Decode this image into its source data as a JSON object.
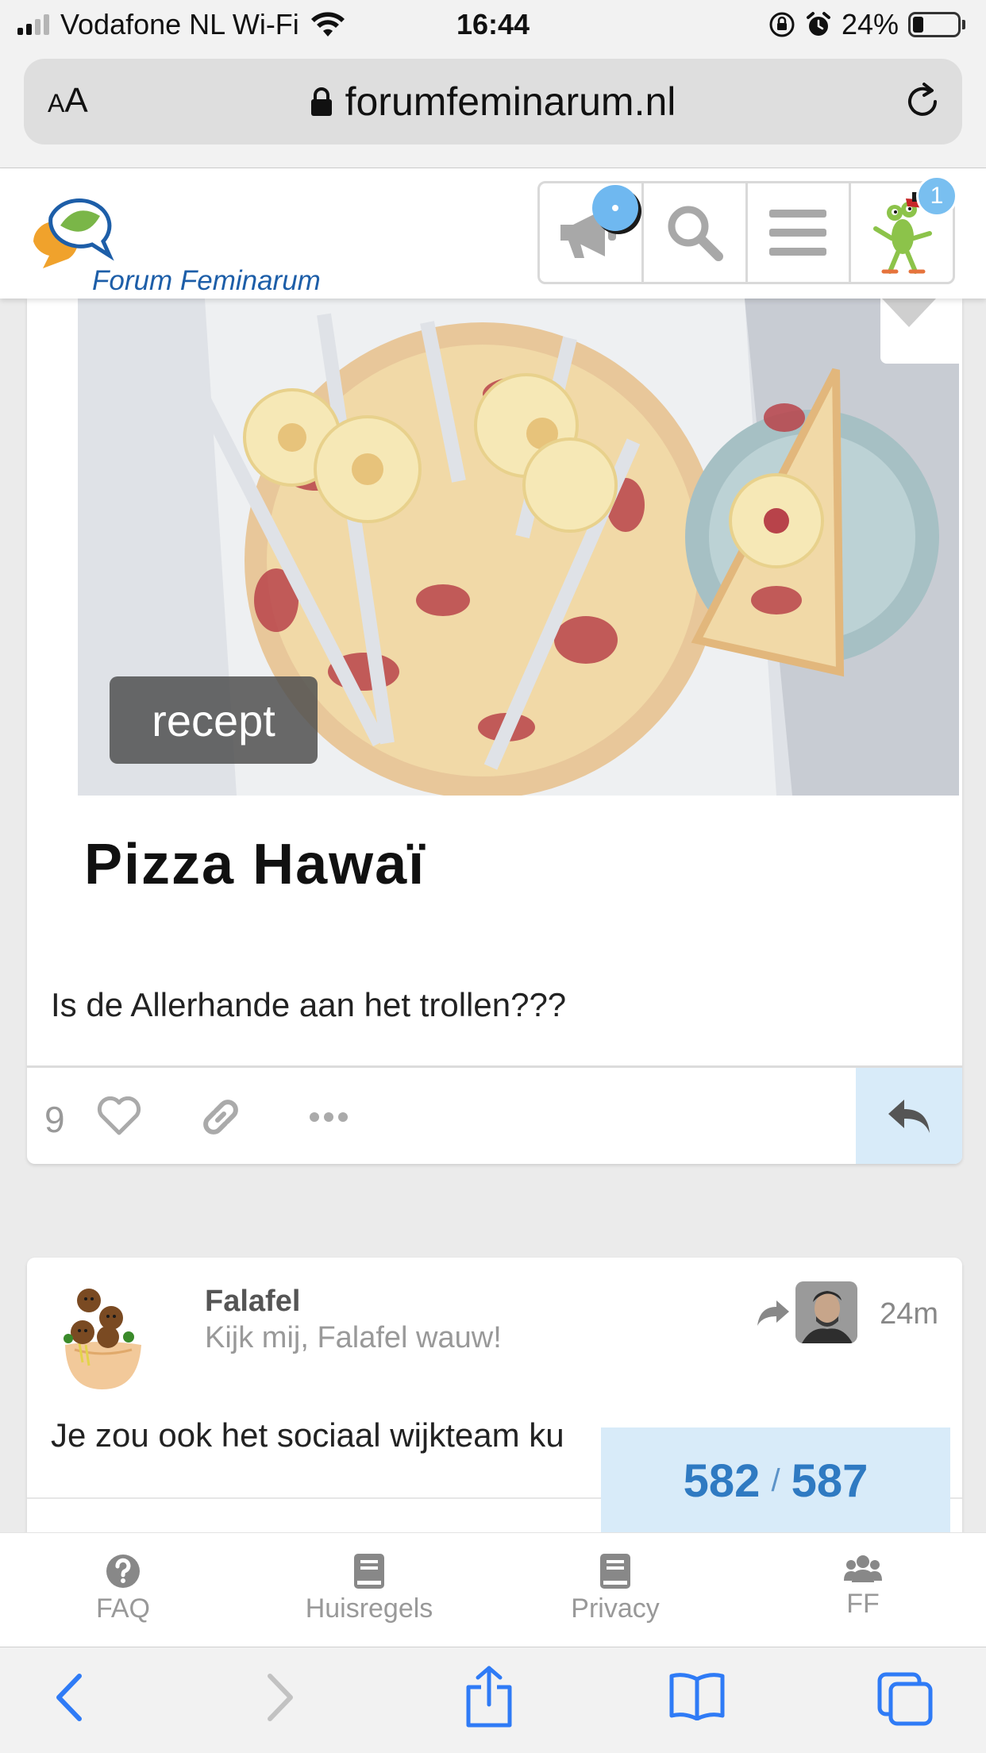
{
  "status_bar": {
    "carrier": "Vodafone NL Wi-Fi",
    "time": "16:44",
    "battery": "24%",
    "battery_level": 0.24
  },
  "browser": {
    "text_size_label_small": "A",
    "text_size_label_large": "A",
    "url": "forumfeminarum.nl"
  },
  "forum_header": {
    "logo_text": "Forum Feminarum",
    "avatar_badge": "1"
  },
  "post1": {
    "image_badge": "recept",
    "onebox_title": "Pizza Hawaï",
    "text": "Is de Allerhande aan het trollen???",
    "like_count": "9"
  },
  "post2": {
    "username": "Falafel",
    "user_title": "Kijk mij, Falafel wauw!",
    "time": "24m",
    "text": "Je zou ook het sociaal wijkteam ku"
  },
  "timeline": {
    "current": "582",
    "separator": "/",
    "total": "587"
  },
  "footer_nav": {
    "items": [
      {
        "label": "FAQ",
        "icon": "question-circle-icon"
      },
      {
        "label": "Huisregels",
        "icon": "book-icon"
      },
      {
        "label": "Privacy",
        "icon": "book-icon"
      },
      {
        "label": "FF",
        "icon": "users-icon"
      }
    ]
  },
  "colors": {
    "accent_blue": "#2f7ac2",
    "light_blue": "#d8ebf9",
    "badge_blue": "#79bff0",
    "logo_blue": "#1d5ea8"
  }
}
